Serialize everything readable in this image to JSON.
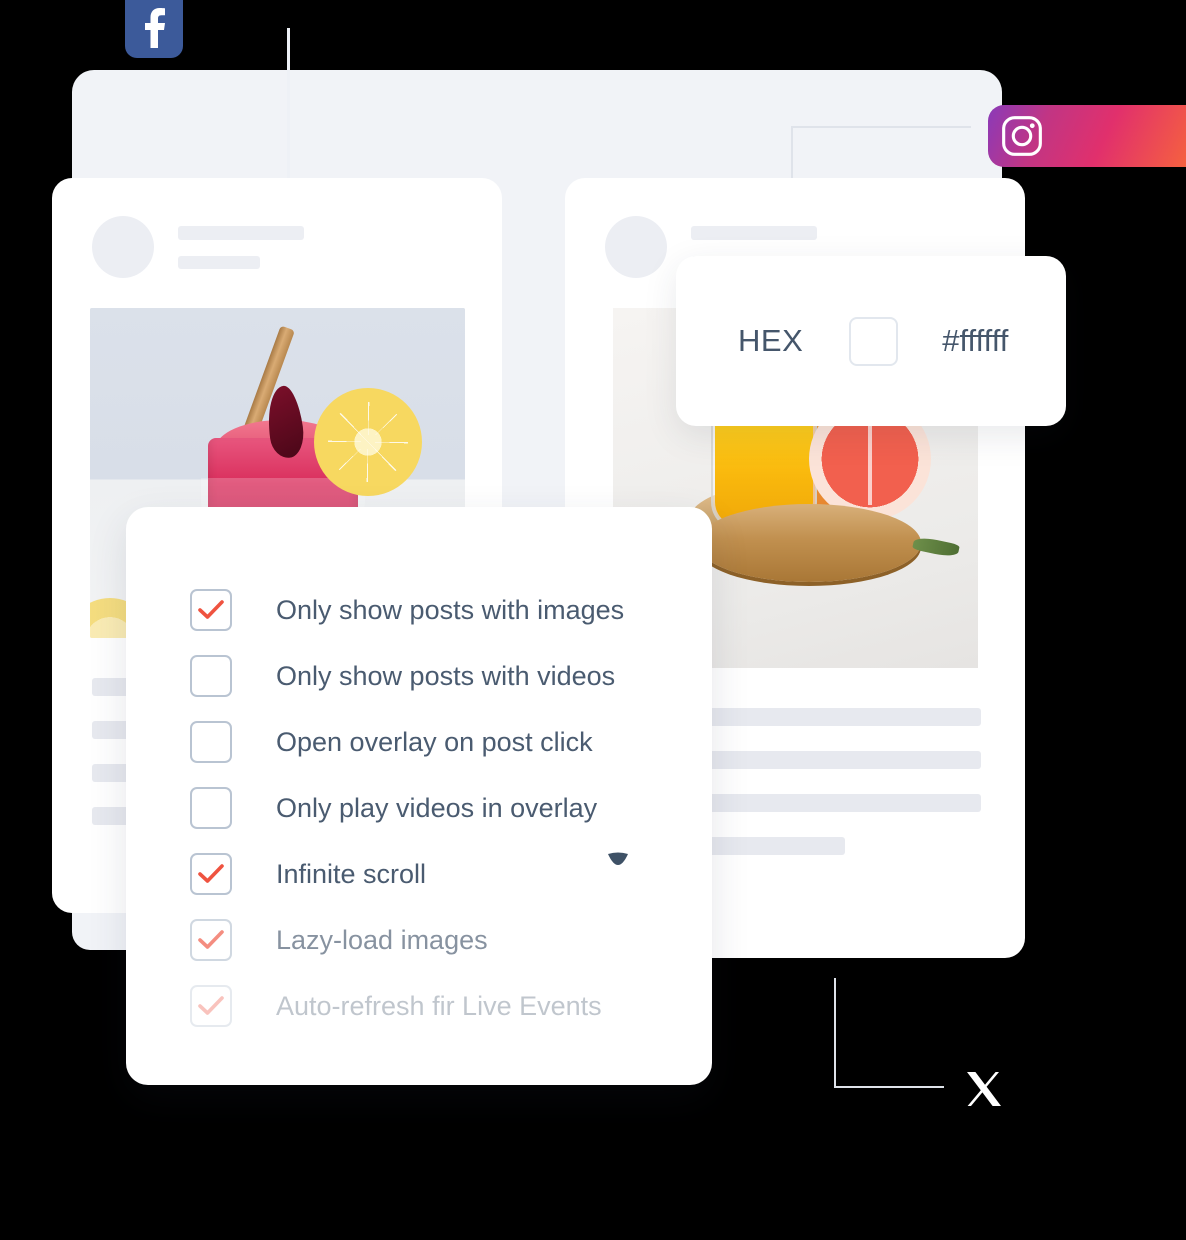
{
  "social_icons": [
    {
      "name": "facebook",
      "glyph": "f",
      "color": "#3c5a9a"
    },
    {
      "name": "instagram",
      "glyph": "camera",
      "color": "#e1306c"
    },
    {
      "name": "x-twitter",
      "glyph": "X",
      "color": "#ffffff"
    }
  ],
  "hex_panel": {
    "label": "HEX",
    "swatch_color": "#ffffff",
    "value": "#ffffff"
  },
  "settings_panel": {
    "options": [
      {
        "label": "Only show posts with images",
        "checked": true,
        "fade": 0
      },
      {
        "label": "Only show posts with videos",
        "checked": false,
        "fade": 0
      },
      {
        "label": "Open overlay on post click",
        "checked": false,
        "fade": 0
      },
      {
        "label": "Only play videos in overlay",
        "checked": false,
        "fade": 0
      },
      {
        "label": "Infinite scroll",
        "checked": true,
        "fade": 0
      },
      {
        "label": "Lazy-load images",
        "checked": true,
        "fade": 1
      },
      {
        "label": "Auto-refresh fir Live Events",
        "checked": true,
        "fade": 2
      }
    ],
    "check_color": "#ef5340",
    "box_border_color": "#b9c4d2",
    "text_color": "#4a5b70"
  },
  "post_cards": [
    {
      "name": "left-post-card",
      "image_alt": "pink iced hibiscus drink with lemon slice and cinnamon straw",
      "skeleton_lines": 4
    },
    {
      "name": "right-post-card",
      "image_alt": "glass of orange juice with mint and halved grapefruit on wood slice",
      "skeleton_lines": 4
    }
  ],
  "colors": {
    "background_card": "#f1f3f7",
    "card": "#ffffff",
    "skeleton": "#eceef3",
    "connector": "#dfe3ea",
    "accent": "#ef5340"
  }
}
